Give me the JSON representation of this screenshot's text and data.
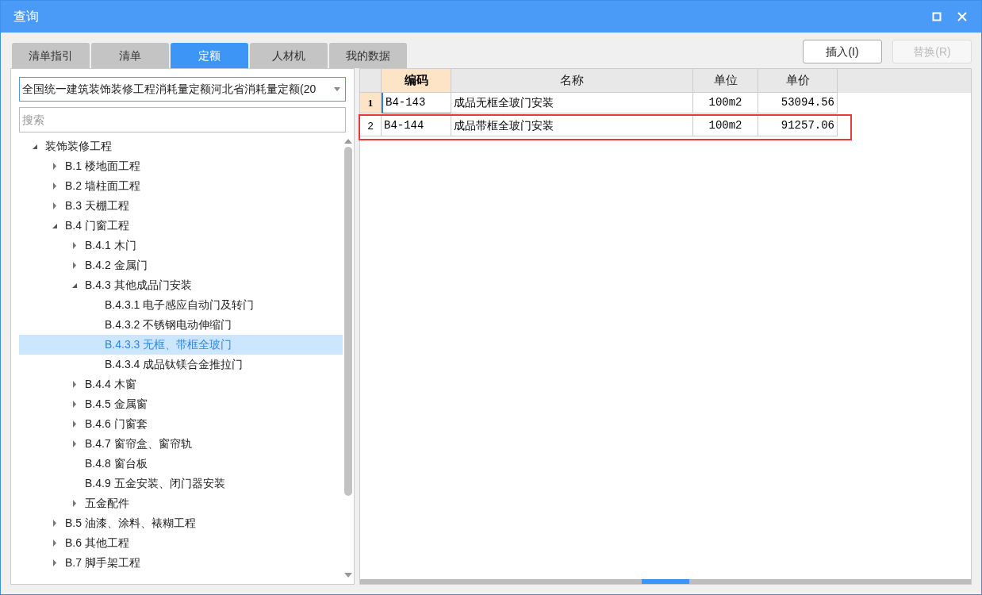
{
  "window": {
    "title": "查询"
  },
  "tabs": [
    {
      "label": "清单指引",
      "selected": false
    },
    {
      "label": "清单",
      "selected": false
    },
    {
      "label": "定额",
      "selected": true
    },
    {
      "label": "人材机",
      "selected": false
    },
    {
      "label": "我的数据",
      "selected": false
    }
  ],
  "library_select": {
    "value": "全国统一建筑装饰装修工程消耗量定额河北省消耗量定额(20"
  },
  "search": {
    "placeholder": "搜索"
  },
  "tree": [
    {
      "label": "装饰装修工程",
      "expanded": true,
      "selected": false,
      "children": [
        {
          "label": "B.1 楼地面工程",
          "expanded": false,
          "selected": false
        },
        {
          "label": "B.2 墙柱面工程",
          "expanded": false,
          "selected": false
        },
        {
          "label": "B.3 天棚工程",
          "expanded": false,
          "selected": false
        },
        {
          "label": "B.4 门窗工程",
          "expanded": true,
          "selected": false,
          "children": [
            {
              "label": "B.4.1 木门",
              "expanded": false,
              "selected": false
            },
            {
              "label": "B.4.2 金属门",
              "expanded": false,
              "selected": false
            },
            {
              "label": "B.4.3 其他成品门安装",
              "expanded": true,
              "selected": false,
              "children": [
                {
                  "label": "B.4.3.1 电子感应自动门及转门",
                  "selected": false
                },
                {
                  "label": "B.4.3.2 不锈钢电动伸缩门",
                  "selected": false
                },
                {
                  "label": "B.4.3.3 无框、带框全玻门",
                  "selected": true
                },
                {
                  "label": "B.4.3.4 成品钛镁合金推拉门",
                  "selected": false
                }
              ]
            },
            {
              "label": "B.4.4 木窗",
              "expanded": false,
              "selected": false
            },
            {
              "label": "B.4.5 金属窗",
              "expanded": false,
              "selected": false
            },
            {
              "label": "B.4.6 门窗套",
              "expanded": false,
              "selected": false
            },
            {
              "label": "B.4.7 窗帘盒、窗帘轨",
              "expanded": false,
              "selected": false
            },
            {
              "label": "B.4.8 窗台板",
              "selected": false
            },
            {
              "label": "B.4.9 五金安装、闭门器安装",
              "selected": false
            },
            {
              "label": "五金配件",
              "expanded": false,
              "selected": false
            }
          ]
        },
        {
          "label": "B.5 油漆、涂料、裱糊工程",
          "expanded": false,
          "selected": false
        },
        {
          "label": "B.6 其他工程",
          "expanded": false,
          "selected": false
        },
        {
          "label": "B.7 脚手架工程",
          "expanded": false,
          "selected": false
        }
      ]
    }
  ],
  "buttons": [
    {
      "label": "插入(I)",
      "disabled": false
    },
    {
      "label": "替换(R)",
      "disabled": true
    }
  ],
  "table": {
    "columns": [
      {
        "label": "编码",
        "selected": true
      },
      {
        "label": "名称",
        "selected": false
      },
      {
        "label": "单位",
        "selected": false
      },
      {
        "label": "单价",
        "selected": false
      }
    ],
    "rows": [
      {
        "number": "1",
        "selected": true,
        "outlined": false,
        "cells": [
          "B4-143",
          "成品无框全玻门安装",
          "100m2",
          "53094.56"
        ]
      },
      {
        "number": "2",
        "selected": false,
        "outlined": true,
        "cells": [
          "B4-144",
          "成品带框全玻门安装",
          "100m2",
          "91257.06"
        ]
      }
    ]
  }
}
